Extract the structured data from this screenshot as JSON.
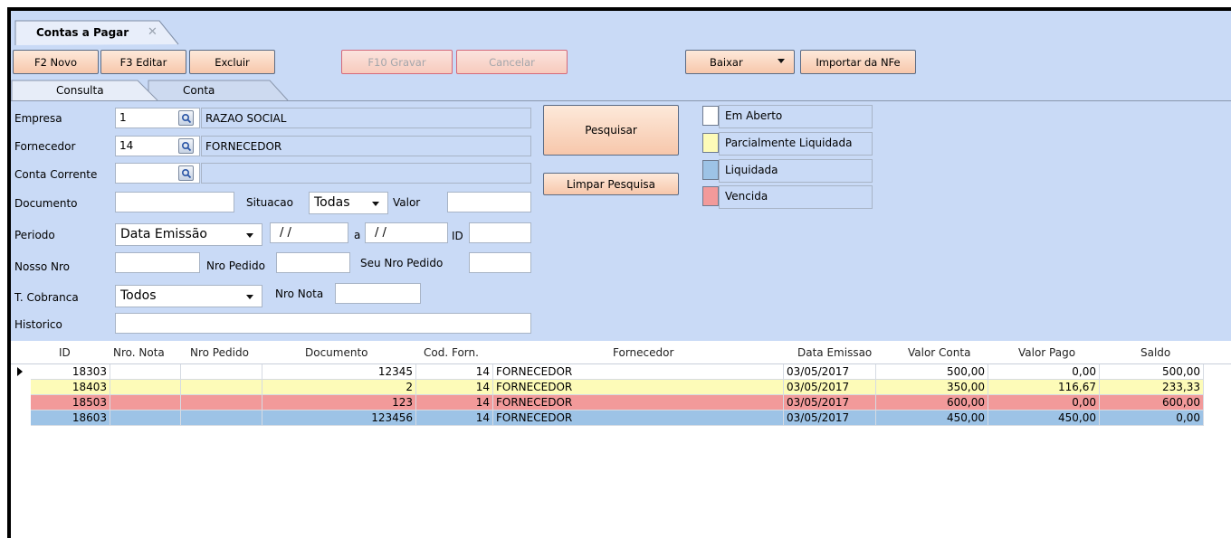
{
  "window": {
    "doc_tab": "Contas a Pagar",
    "doc_tab_close": "✕"
  },
  "toolbar": {
    "novo": "F2 Novo",
    "editar": "F3 Editar",
    "excluir": "Excluir",
    "gravar": "F10 Gravar",
    "cancelar": "Cancelar",
    "baixar": "Baixar",
    "importar": "Importar da NFe"
  },
  "subtabs": {
    "consulta": "Consulta",
    "conta": "Conta"
  },
  "form": {
    "empresa_label": "Empresa",
    "empresa_code": "1",
    "empresa_name": "RAZAO SOCIAL",
    "fornecedor_label": "Fornecedor",
    "fornecedor_code": "14",
    "fornecedor_name": "FORNECEDOR",
    "conta_corrente_label": "Conta Corrente",
    "conta_corrente_code": "",
    "conta_corrente_name": "",
    "documento_label": "Documento",
    "documento_value": "",
    "situacao_label": "Situacao",
    "situacao_value": "Todas",
    "valor_label": "Valor",
    "valor_value": "",
    "periodo_label": "Periodo",
    "periodo_value": "Data Emissão",
    "date_from": "/ /",
    "a_label": "a",
    "date_to": "/ /",
    "id_label": "ID",
    "id_value": "",
    "nosso_nro_label": "Nosso Nro",
    "nosso_nro_value": "",
    "nro_pedido_label": "Nro Pedido",
    "nro_pedido_value": "",
    "seu_nro_pedido_label": "Seu Nro Pedido",
    "seu_nro_pedido_value": "",
    "t_cobranca_label": "T. Cobranca",
    "t_cobranca_value": "Todos",
    "nro_nota_label": "Nro Nota",
    "nro_nota_value": "",
    "historico_label": "Historico",
    "historico_value": ""
  },
  "actions": {
    "pesquisar": "Pesquisar",
    "limpar": "Limpar Pesquisa"
  },
  "legend": [
    {
      "label": "Em Aberto",
      "color": "#ffffff"
    },
    {
      "label": "Parcialmente Liquidada",
      "color": "#fdfbb8"
    },
    {
      "label": "Liquidada",
      "color": "#9dc3e6"
    },
    {
      "label": "Vencida",
      "color": "#f29a9a"
    }
  ],
  "grid": {
    "columns": [
      "ID",
      "Nro. Nota",
      "Nro Pedido",
      "Documento",
      "Cod. Forn.",
      "Fornecedor",
      "Data Emissao",
      "Valor Conta",
      "Valor Pago",
      "Saldo"
    ],
    "rows": [
      {
        "id": "18303",
        "nro_nota": "",
        "nro_pedido": "",
        "documento": "12345",
        "cod_forn": "14",
        "fornecedor": "FORNECEDOR",
        "data_emissao": "03/05/2017",
        "valor_conta": "500,00",
        "valor_pago": "0,00",
        "saldo": "500,00",
        "status_color": "#ffffff"
      },
      {
        "id": "18403",
        "nro_nota": "",
        "nro_pedido": "",
        "documento": "2",
        "cod_forn": "14",
        "fornecedor": "FORNECEDOR",
        "data_emissao": "03/05/2017",
        "valor_conta": "350,00",
        "valor_pago": "116,67",
        "saldo": "233,33",
        "status_color": "#fdfbb8"
      },
      {
        "id": "18503",
        "nro_nota": "",
        "nro_pedido": "",
        "documento": "123",
        "cod_forn": "14",
        "fornecedor": "FORNECEDOR",
        "data_emissao": "03/05/2017",
        "valor_conta": "600,00",
        "valor_pago": "0,00",
        "saldo": "600,00",
        "status_color": "#f29a9a"
      },
      {
        "id": "18603",
        "nro_nota": "",
        "nro_pedido": "",
        "documento": "123456",
        "cod_forn": "14",
        "fornecedor": "FORNECEDOR",
        "data_emissao": "03/05/2017",
        "valor_conta": "450,00",
        "valor_pago": "450,00",
        "saldo": "0,00",
        "status_color": "#9dc3e6"
      }
    ]
  }
}
